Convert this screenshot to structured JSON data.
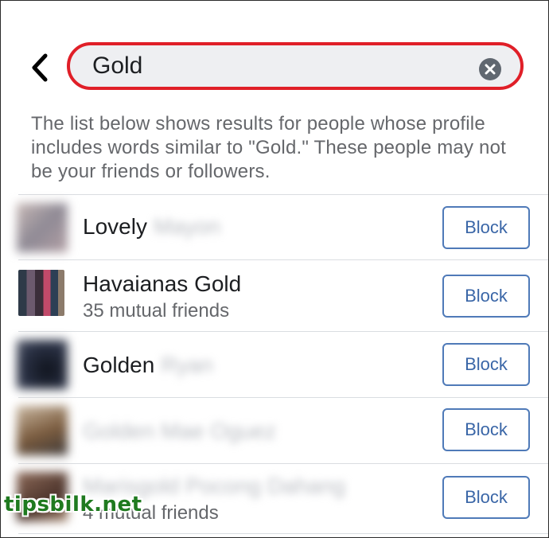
{
  "search": {
    "value": "Gold",
    "placeholder": "Search"
  },
  "notice": "The list below shows results for people whose profile includes words similar to \"Gold.\" These people may not be your friends or followers.",
  "results": [
    {
      "name": "Lovely",
      "name_hidden": "Mayon",
      "mutual": "",
      "button": "Block",
      "avatar_color": "#b0a4a8"
    },
    {
      "name": "Havaianas Gold",
      "name_hidden": "",
      "mutual": "35 mutual friends",
      "button": "Block",
      "avatar_color": "#4a4a52"
    },
    {
      "name": "Golden",
      "name_hidden": "Ryan",
      "mutual": "",
      "button": "Block",
      "avatar_color": "#1b2130"
    },
    {
      "name": "",
      "name_hidden": "Golden Mae Oguez",
      "mutual": "",
      "button": "Block",
      "avatar_color": "#8a6a4a"
    },
    {
      "name": "",
      "name_hidden": "Marisgold Pocong Dahang",
      "mutual": "4 mutual friends",
      "button": "Block",
      "avatar_color": "#6a4a3a"
    }
  ],
  "watermark": "tipsbilk.net",
  "colors": {
    "search_border": "#e01f28",
    "search_bg": "#eeeff2",
    "button_border": "#4f7ab8",
    "button_text": "#3a66a7",
    "secondary_text": "#65676b",
    "watermark": "#1f7a1f"
  },
  "icons": {
    "back": "chevron-left-icon",
    "clear": "clear-circle-icon"
  }
}
